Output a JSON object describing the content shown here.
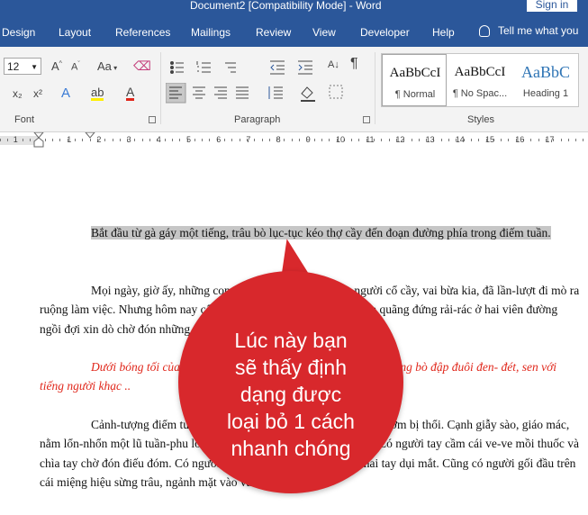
{
  "window": {
    "title": "Document2 [Compatibility Mode]  -  Word",
    "signin": "Sign in"
  },
  "tabs": [
    "Design",
    "Layout",
    "References",
    "Mailings",
    "Review",
    "View",
    "Developer",
    "Help"
  ],
  "tell_me": "Tell me what you",
  "ribbon": {
    "font_size": "12",
    "groups": {
      "font": "Font",
      "paragraph": "Paragraph",
      "styles": "Styles"
    },
    "styles": [
      {
        "sample": "AaBbCcI",
        "name": "¶ Normal",
        "selected": true
      },
      {
        "sample": "AaBbCcI",
        "name": "¶ No Spac...",
        "selected": false
      },
      {
        "sample": "AaBbC",
        "name": "Heading 1",
        "selected": false
      }
    ],
    "buttons": {
      "grow": "A",
      "shrink": "A",
      "change_case": "Aa",
      "subscript": "x₂",
      "superscript": "x²",
      "text_effects": "A",
      "highlight": "ab",
      "font_color": "A",
      "pilcrow": "¶"
    }
  },
  "ruler": {
    "numbers": [
      "1",
      "1",
      "2",
      "3",
      "4",
      "5",
      "6",
      "7",
      "8",
      "9",
      "10",
      "11",
      "12",
      "13",
      "14",
      "15",
      "16",
      "17"
    ]
  },
  "document": {
    "p1": "Bắt đầu từ gà gáy một tiếng, trâu bò lục-tục kéo thợ cầy đến đoạn đường phía trong điếm tuần.",
    "p2": "Mọi ngày, giờ ấy, những con vật này cũng như những người cổ cầy, vai bừa kia, đã lần-lượt đi mò ra ruộng làm việc. Nhưng hôm nay cổng làng chưa mở, chúng phải chia quãng đứng rải-rác ở hai viên đường ngồi đợi xin dò chờ đón những ông quan lớn.",
    "p3": "Dưới bóng tối của những nhà cổ thụ, tiếng trâu thở phì-phò, tiếng bò đập đuôi đen- đét, sen với tiếng người khạc ..",
    "p4": "Cảnh-tượng điểm tuần lấp-lóe ánh lửa lập-lòe của chiếc mồi rơm bị thổi. Cạnh giẫy sào, giáo mác, nằm lổn-nhổn một lũ tuần-phu lố-nhố ngồi trên lớp chiếu quần-quèo. Có người tay cầm cái ve-ve mồi thuốc và chìa tay chờ đón điếu đóm. Có người há miệng ngáp dài, tay đang hai tay dụi mắt. Cũng có người gối đầu trên cái miệng hiệu sừng trâu, ngảnh mặt vào vách mà ngáy."
  },
  "callout": {
    "lines": [
      "Lúc này bạn",
      "sẽ thấy định",
      "dạng được",
      "loại bỏ 1 cách",
      "nhanh chóng"
    ],
    "color": "#d8282c"
  },
  "colors": {
    "accent": "#2b579a",
    "highlight": "#c6c6c6",
    "red_text": "#e0261a",
    "heading": "#2e74b5"
  }
}
